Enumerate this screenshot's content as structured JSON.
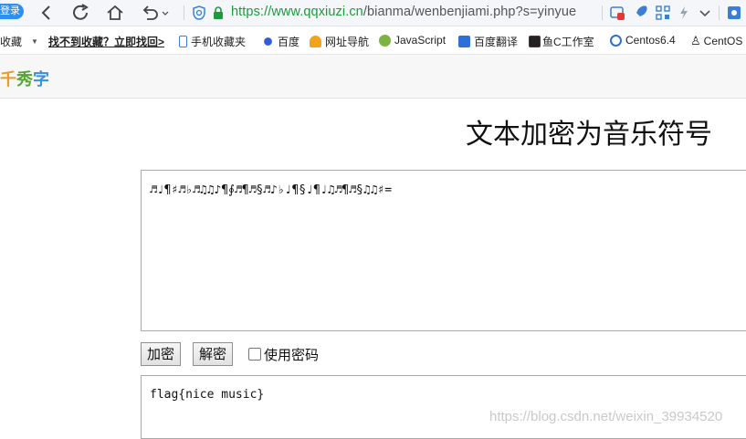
{
  "browser": {
    "login_label": "登录",
    "url_host": "https://www.qqxiuzi.cn",
    "url_path": "/bianma/wenbenjiami.php?s=yinyue"
  },
  "bookmarks": [
    {
      "label": "收藏"
    },
    {
      "label": "找不到收藏？立即找回>"
    },
    {
      "label": "手机收藏夹"
    },
    {
      "label": "百度"
    },
    {
      "label": "网址导航"
    },
    {
      "label": "JavaScript"
    },
    {
      "label": "百度翻译"
    },
    {
      "label": "鱼C工作室"
    },
    {
      "label": "Centos6.4"
    },
    {
      "label": "CentOS"
    }
  ],
  "site": {
    "logo_1": "千",
    "logo_2": "秀",
    "logo_3": "字"
  },
  "page": {
    "title": "文本加密为音乐符号",
    "input_text": "♬♩¶♯♬♭♬♫♫♪¶∮♬¶♬§♬♪♭♩¶§♩¶♩♫♬¶♬§♫♫♯=",
    "encrypt_button": "加密",
    "decrypt_button": "解密",
    "use_password_label": "使用密码",
    "use_password_checked": false,
    "output_text": "flag{nice music}"
  },
  "watermark": "https://blog.csdn.net/weixin_39934520"
}
